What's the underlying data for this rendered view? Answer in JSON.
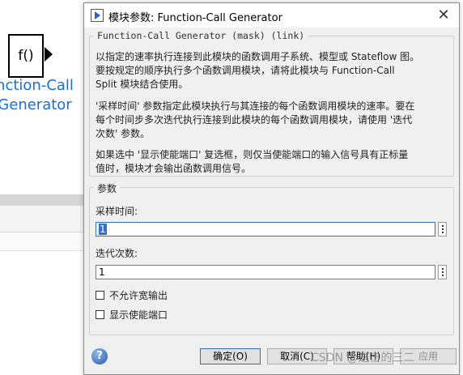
{
  "canvas": {
    "block_symbol": "f()",
    "block_name_line1": "nction-Call",
    "block_name_line2": "Generator"
  },
  "dialog": {
    "title": "模块参数: Function-Call Generator",
    "close_glyph": "✕",
    "description": {
      "group_title": "Function-Call Generator (mask) (link)",
      "lines": [
        "以指定的速率执行连接到此模块的函数调用子系统、模型或 Stateflow 图。",
        "要按规定的顺序执行多个函数调用模块，请将此模块与 Function-Call",
        "Split 模块结合使用。",
        "'采样时间' 参数指定此模块执行与其连接的每个函数调用模块的速率。要在",
        "每个时间步多次迭代执行连接到此模块的每个函数调用模块，请使用 '迭代",
        "次数' 参数。",
        "如果选中 '显示使能端口' 复选框，则仅当使能端口的输入信号具有正标量",
        "值时，模块才会输出函数调用信号。"
      ]
    },
    "params": {
      "group_title": "参数",
      "sample_time_label": "采样时间:",
      "sample_time_value": "1",
      "iterations_label": "迭代次数:",
      "iterations_value": "1",
      "checkbox_no_wide_output": "不允许宽输出",
      "checkbox_show_enable_port": "显示使能端口"
    },
    "buttons": {
      "help_icon": "?",
      "ok": "确定(O)",
      "cancel": "取消(C)",
      "help": "帮助(H)",
      "apply": "应用"
    }
  },
  "watermark": "CSDN @进击的三二"
}
